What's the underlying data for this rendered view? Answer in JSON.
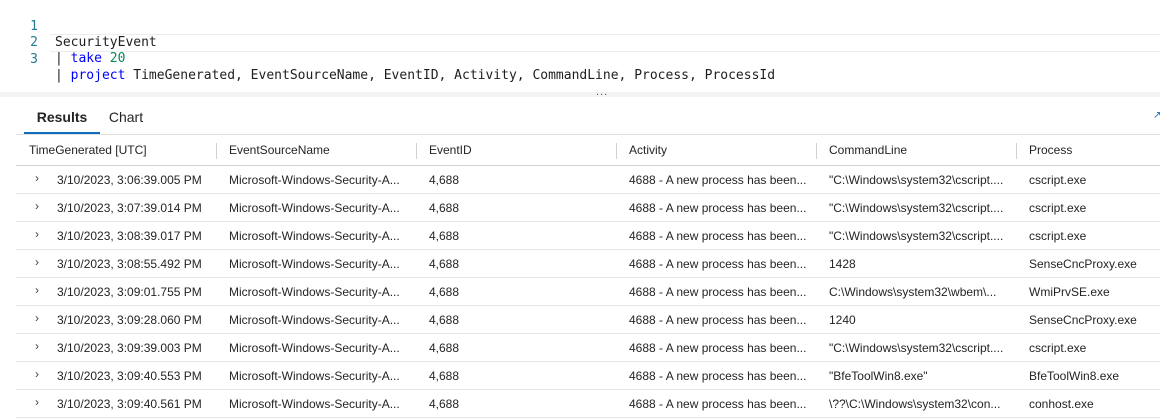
{
  "editor": {
    "lines": [
      {
        "num": "1",
        "text": "SecurityEvent"
      },
      {
        "num": "2",
        "pipe": "| ",
        "keyword": "take",
        "value": "20"
      },
      {
        "num": "3",
        "pipe": "| ",
        "keyword": "project",
        "text": "TimeGenerated, EventSourceName, EventID, Activity, CommandLine, Process, ProcessId"
      }
    ]
  },
  "splitter": {
    "grip": "..."
  },
  "tabs": [
    {
      "label": "Results",
      "active": true
    },
    {
      "label": "Chart",
      "active": false
    }
  ],
  "grid": {
    "columns": [
      "TimeGenerated [UTC]",
      "EventSourceName",
      "EventID",
      "Activity",
      "CommandLine",
      "Process"
    ],
    "rows": [
      [
        "3/10/2023, 3:06:39.005 PM",
        "Microsoft-Windows-Security-A...",
        "4,688",
        "4688 - A new process has been...",
        "\"C:\\Windows\\system32\\cscript....",
        "cscript.exe"
      ],
      [
        "3/10/2023, 3:07:39.014 PM",
        "Microsoft-Windows-Security-A...",
        "4,688",
        "4688 - A new process has been...",
        "\"C:\\Windows\\system32\\cscript....",
        "cscript.exe"
      ],
      [
        "3/10/2023, 3:08:39.017 PM",
        "Microsoft-Windows-Security-A...",
        "4,688",
        "4688 - A new process has been...",
        "\"C:\\Windows\\system32\\cscript....",
        "cscript.exe"
      ],
      [
        "3/10/2023, 3:08:55.492 PM",
        "Microsoft-Windows-Security-A...",
        "4,688",
        "4688 - A new process has been...",
        "1428",
        "SenseCncProxy.exe"
      ],
      [
        "3/10/2023, 3:09:01.755 PM",
        "Microsoft-Windows-Security-A...",
        "4,688",
        "4688 - A new process has been...",
        "C:\\Windows\\system32\\wbem\\...",
        "WmiPrvSE.exe"
      ],
      [
        "3/10/2023, 3:09:28.060 PM",
        "Microsoft-Windows-Security-A...",
        "4,688",
        "4688 - A new process has been...",
        "1240",
        "SenseCncProxy.exe"
      ],
      [
        "3/10/2023, 3:09:39.003 PM",
        "Microsoft-Windows-Security-A...",
        "4,688",
        "4688 - A new process has been...",
        "\"C:\\Windows\\system32\\cscript....",
        "cscript.exe"
      ],
      [
        "3/10/2023, 3:09:40.553 PM",
        "Microsoft-Windows-Security-A...",
        "4,688",
        "4688 - A new process has been...",
        "\"BfeToolWin8.exe\"",
        "BfeToolWin8.exe"
      ],
      [
        "3/10/2023, 3:09:40.561 PM",
        "Microsoft-Windows-Security-A...",
        "4,688",
        "4688 - A new process has been...",
        "\\??\\C:\\Windows\\system32\\con...",
        "conhost.exe"
      ]
    ],
    "expander_icon": "chevron-right-icon"
  },
  "colors": {
    "accent": "#0f6cbd",
    "keyword": "#0000ff",
    "number": "#09885a",
    "line_number": "#237893"
  }
}
